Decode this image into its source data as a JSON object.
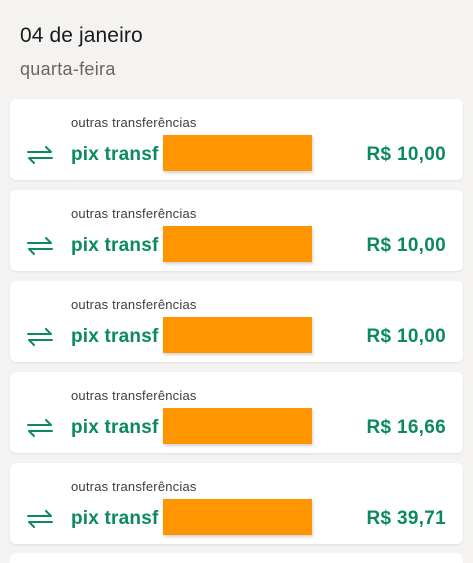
{
  "header": {
    "date": "04 de janeiro",
    "weekday": "quarta-feira"
  },
  "colors": {
    "accent_green": "#0b8a5c",
    "redaction_orange": "#ff9500",
    "background": "#f4f3f1"
  },
  "transactions": [
    {
      "category": "outras transferências",
      "name": "pix transf",
      "amount": "R$ 10,00",
      "icon": "transfer-arrows-icon"
    },
    {
      "category": "outras transferências",
      "name": "pix transf",
      "amount": "R$ 10,00",
      "icon": "transfer-arrows-icon"
    },
    {
      "category": "outras transferências",
      "name": "pix transf",
      "amount": "R$ 10,00",
      "icon": "transfer-arrows-icon"
    },
    {
      "category": "outras transferências",
      "name": "pix transf",
      "amount": "R$ 16,66",
      "icon": "transfer-arrows-icon"
    },
    {
      "category": "outras transferências",
      "name": "pix transf",
      "amount": "R$ 39,71",
      "icon": "transfer-arrows-icon"
    }
  ]
}
